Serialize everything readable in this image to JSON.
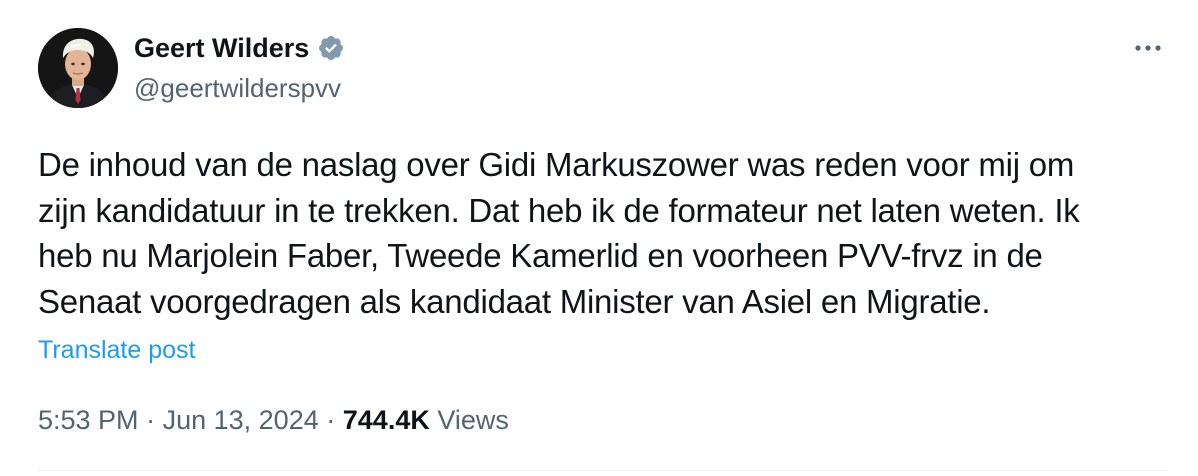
{
  "author": {
    "display_name": "Geert Wilders",
    "handle": "@geertwilderspvv",
    "verified_icon": "verified-badge-icon",
    "verified_color": "#829aab"
  },
  "more_icon": "more-options-icon",
  "tweet": {
    "text": "De inhoud van de naslag over Gidi Markuszower was reden voor mij om\nzijn kandidatuur in te trekken. Dat heb ik de formateur net laten weten. Ik\nheb nu Marjolein Faber, Tweede Kamerlid en voorheen PVV-frvz in de\nSenaat voorgedragen als kandidaat Minister van Asiel en Migratie."
  },
  "translate_label": "Translate post",
  "meta": {
    "time": "5:53 PM",
    "separator": "·",
    "date": "Jun 13, 2024",
    "views_count": "744.4K",
    "views_label": "Views"
  },
  "colors": {
    "text_primary": "#0f1419",
    "text_secondary": "#536471",
    "link": "#1d9bf0",
    "divider": "#eff3f4"
  }
}
